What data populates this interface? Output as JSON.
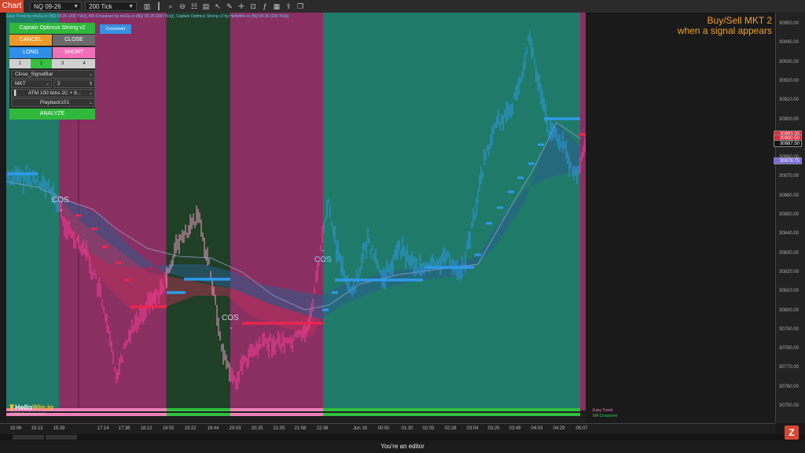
{
  "toolbar": {
    "chart_tab": "Chart",
    "instrument": "NQ 09-26",
    "interval": "200 Tick"
  },
  "indicator_title": "Easy Trend by ninZa.co (NQ 09-26 (200 Tick)), MA Crossover by ninZa.co (NQ 09-26 (200 Tick)), Captain Optimus Strong v2 by HelloWin.io (NQ 09-26 (200 Tick))",
  "banner": {
    "line1": "Buy/Sell MKT 2",
    "line2": "when a signal appears"
  },
  "panel": {
    "title": "Captain Optimus Strong v2",
    "cancel": "CANCEL",
    "close": "CLOSE",
    "long": "LONG",
    "short": "SHORT",
    "numbers": [
      "1",
      "2",
      "3",
      "4"
    ],
    "signal_mode": "Close_SignalBar",
    "order_type": "MKT",
    "quantity": "2",
    "atm": "ATM 100 ticks 2C + 8...",
    "account": "Playback101",
    "analyze": "ANALYZE"
  },
  "crossover_button": "Crossover",
  "annotations": {
    "cos": "COS"
  },
  "price_axis": {
    "ticks": [
      "30950.00",
      "30940.00",
      "30930.00",
      "30920.00",
      "30910.00",
      "30900.00",
      "30890.00",
      "30880.00",
      "30870.00",
      "30860.00",
      "30850.00",
      "30840.00",
      "30830.00",
      "30820.00",
      "30810.00",
      "30800.00",
      "30790.00",
      "30780.00",
      "30770.00",
      "30760.00",
      "30750.00"
    ],
    "tags": [
      {
        "label": "30893.00",
        "color": "#d8283a"
      },
      {
        "label": "30890.50",
        "color": "#d8283a"
      },
      {
        "label": "30887.50",
        "color": "#111111"
      },
      {
        "label": "30878.75",
        "color": "#7a6ad8"
      }
    ]
  },
  "time_axis": [
    "15:06",
    "15:13",
    "15:39",
    "17:14",
    "17:38",
    "18:12",
    "18:55",
    "19:22",
    "19:44",
    "20:03",
    "20:25",
    "21:05",
    "21:58",
    "22:38",
    "Jun 16",
    "00:50",
    "01:30",
    "02:05",
    "02:28",
    "03:04",
    "03:25",
    "03:49",
    "04:03",
    "04:29",
    "05:07"
  ],
  "legend": {
    "easy_trend": "Easy Trend",
    "ma_crossover": "MA Crossover"
  },
  "logo": {
    "name_a": "Hello",
    "name_b": "Win.io",
    "copyright": "© 2025 NinjaTrader, LLC"
  },
  "footer": "You're an editor",
  "colors": {
    "bull_zone": "#1f7a6a",
    "bear_zone": "#8a2f62",
    "neutral_zone": "#1f3f26",
    "bull": "#2f9ae8",
    "bear": "#ff3f9a"
  }
}
